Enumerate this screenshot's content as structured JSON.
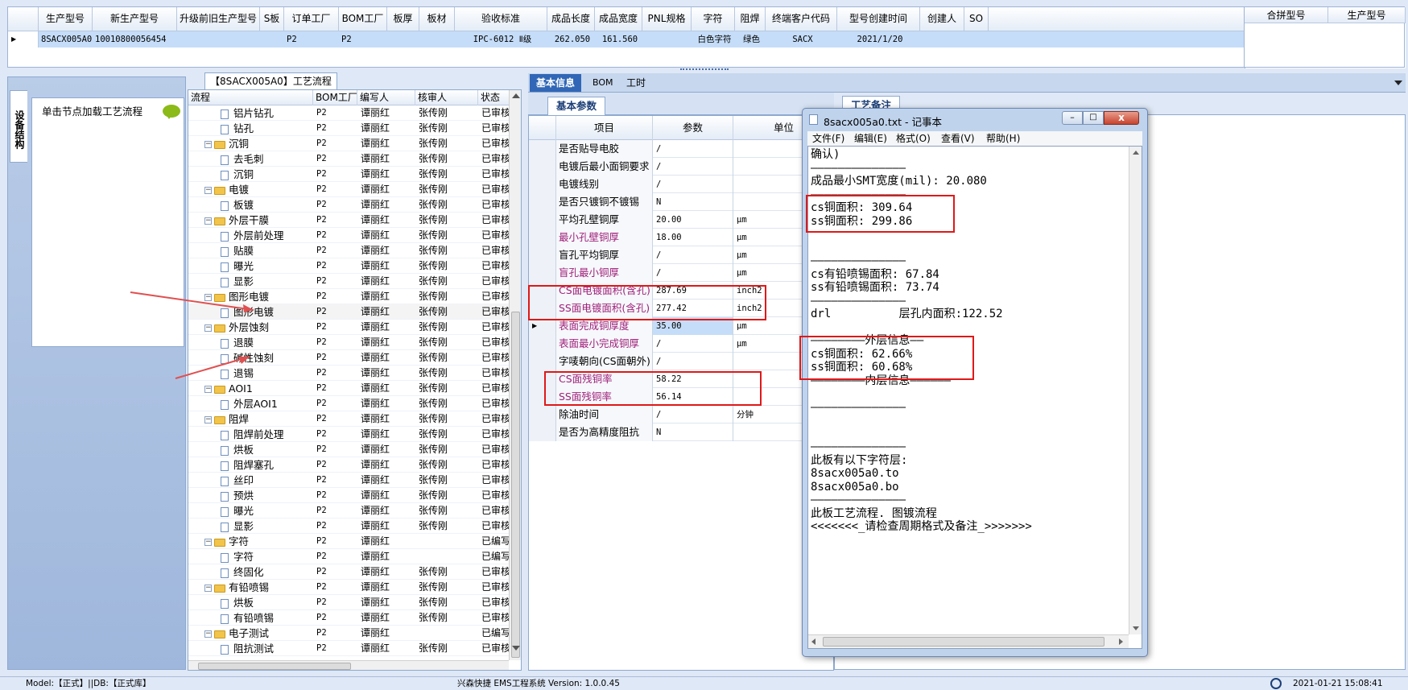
{
  "top_grid": {
    "headers": [
      "生产型号",
      "新生产型号",
      "升级前旧生产型号",
      "S板",
      "订单工厂",
      "BOM工厂",
      "板厚",
      "板材",
      "验收标准",
      "成品长度",
      "成品宽度",
      "PNL规格",
      "字符",
      "阻焊",
      "终端客户代码",
      "型号创建时间",
      "创建人",
      "SO"
    ],
    "row": [
      "8SACX005A0",
      "10010800056454",
      "",
      "",
      "P2",
      "P2",
      "",
      "",
      "IPC-6012 Ⅱ级",
      "262.050",
      "161.560",
      "",
      "白色字符",
      "绿色",
      "SACX",
      "2021/1/20",
      "",
      ""
    ],
    "side_headers": [
      "合拼型号",
      "生产型号"
    ]
  },
  "left_panel": {
    "vertical_tab": "设备结构",
    "hint": "单击节点加载工艺流程"
  },
  "flow_panel": {
    "title": "【8SACX005A0】工艺流程",
    "headers": [
      "流程",
      "BOM工厂",
      "编写人",
      "核审人",
      "状态"
    ],
    "rows": [
      {
        "level": 2,
        "type": "doc",
        "name": "铝片钻孔",
        "bom": "P2",
        "writer": "谭丽红",
        "reviewer": "张传刚",
        "status": "已审核"
      },
      {
        "level": 2,
        "type": "doc",
        "name": "钻孔",
        "bom": "P2",
        "writer": "谭丽红",
        "reviewer": "张传刚",
        "status": "已审核"
      },
      {
        "level": 1,
        "type": "folder",
        "name": "沉铜",
        "bom": "P2",
        "writer": "谭丽红",
        "reviewer": "张传刚",
        "status": "已审核"
      },
      {
        "level": 2,
        "type": "doc",
        "name": "去毛刺",
        "bom": "P2",
        "writer": "谭丽红",
        "reviewer": "张传刚",
        "status": "已审核"
      },
      {
        "level": 2,
        "type": "doc",
        "name": "沉铜",
        "bom": "P2",
        "writer": "谭丽红",
        "reviewer": "张传刚",
        "status": "已审核"
      },
      {
        "level": 1,
        "type": "folder",
        "name": "电镀",
        "bom": "P2",
        "writer": "谭丽红",
        "reviewer": "张传刚",
        "status": "已审核"
      },
      {
        "level": 2,
        "type": "doc",
        "name": "板镀",
        "bom": "P2",
        "writer": "谭丽红",
        "reviewer": "张传刚",
        "status": "已审核"
      },
      {
        "level": 1,
        "type": "folder",
        "name": "外层干膜",
        "bom": "P2",
        "writer": "谭丽红",
        "reviewer": "张传刚",
        "status": "已审核"
      },
      {
        "level": 2,
        "type": "doc",
        "name": "外层前处理",
        "bom": "P2",
        "writer": "谭丽红",
        "reviewer": "张传刚",
        "status": "已审核"
      },
      {
        "level": 2,
        "type": "doc",
        "name": "贴膜",
        "bom": "P2",
        "writer": "谭丽红",
        "reviewer": "张传刚",
        "status": "已审核"
      },
      {
        "level": 2,
        "type": "doc",
        "name": "曝光",
        "bom": "P2",
        "writer": "谭丽红",
        "reviewer": "张传刚",
        "status": "已审核"
      },
      {
        "level": 2,
        "type": "doc",
        "name": "显影",
        "bom": "P2",
        "writer": "谭丽红",
        "reviewer": "张传刚",
        "status": "已审核"
      },
      {
        "level": 1,
        "type": "folder",
        "name": "图形电镀",
        "bom": "P2",
        "writer": "谭丽红",
        "reviewer": "张传刚",
        "status": "已审核"
      },
      {
        "level": 2,
        "type": "doc",
        "name": "图形电镀",
        "bom": "P2",
        "writer": "谭丽红",
        "reviewer": "张传刚",
        "status": "已审核"
      },
      {
        "level": 1,
        "type": "folder",
        "name": "外层蚀刻",
        "bom": "P2",
        "writer": "谭丽红",
        "reviewer": "张传刚",
        "status": "已审核"
      },
      {
        "level": 2,
        "type": "doc",
        "name": "退膜",
        "bom": "P2",
        "writer": "谭丽红",
        "reviewer": "张传刚",
        "status": "已审核"
      },
      {
        "level": 2,
        "type": "doc",
        "name": "碱性蚀刻",
        "bom": "P2",
        "writer": "谭丽红",
        "reviewer": "张传刚",
        "status": "已审核"
      },
      {
        "level": 2,
        "type": "doc",
        "name": "退锡",
        "bom": "P2",
        "writer": "谭丽红",
        "reviewer": "张传刚",
        "status": "已审核"
      },
      {
        "level": 1,
        "type": "folder",
        "name": "AOI1",
        "bom": "P2",
        "writer": "谭丽红",
        "reviewer": "张传刚",
        "status": "已审核"
      },
      {
        "level": 2,
        "type": "doc",
        "name": "外层AOI1",
        "bom": "P2",
        "writer": "谭丽红",
        "reviewer": "张传刚",
        "status": "已审核"
      },
      {
        "level": 1,
        "type": "folder",
        "name": "阻焊",
        "bom": "P2",
        "writer": "谭丽红",
        "reviewer": "张传刚",
        "status": "已审核"
      },
      {
        "level": 2,
        "type": "doc",
        "name": "阻焊前处理",
        "bom": "P2",
        "writer": "谭丽红",
        "reviewer": "张传刚",
        "status": "已审核"
      },
      {
        "level": 2,
        "type": "doc",
        "name": "烘板",
        "bom": "P2",
        "writer": "谭丽红",
        "reviewer": "张传刚",
        "status": "已审核"
      },
      {
        "level": 2,
        "type": "doc",
        "name": "阻焊塞孔",
        "bom": "P2",
        "writer": "谭丽红",
        "reviewer": "张传刚",
        "status": "已审核"
      },
      {
        "level": 2,
        "type": "doc",
        "name": "丝印",
        "bom": "P2",
        "writer": "谭丽红",
        "reviewer": "张传刚",
        "status": "已审核"
      },
      {
        "level": 2,
        "type": "doc",
        "name": "预烘",
        "bom": "P2",
        "writer": "谭丽红",
        "reviewer": "张传刚",
        "status": "已审核"
      },
      {
        "level": 2,
        "type": "doc",
        "name": "曝光",
        "bom": "P2",
        "writer": "谭丽红",
        "reviewer": "张传刚",
        "status": "已审核"
      },
      {
        "level": 2,
        "type": "doc",
        "name": "显影",
        "bom": "P2",
        "writer": "谭丽红",
        "reviewer": "张传刚",
        "status": "已审核"
      },
      {
        "level": 1,
        "type": "folder",
        "name": "字符",
        "bom": "P2",
        "writer": "谭丽红",
        "reviewer": "",
        "status": "已编写"
      },
      {
        "level": 2,
        "type": "doc",
        "name": "字符",
        "bom": "P2",
        "writer": "谭丽红",
        "reviewer": "",
        "status": "已编写"
      },
      {
        "level": 2,
        "type": "doc",
        "name": "终固化",
        "bom": "P2",
        "writer": "谭丽红",
        "reviewer": "张传刚",
        "status": "已审核"
      },
      {
        "level": 1,
        "type": "folder",
        "name": "有铅喷锡",
        "bom": "P2",
        "writer": "谭丽红",
        "reviewer": "张传刚",
        "status": "已审核"
      },
      {
        "level": 2,
        "type": "doc",
        "name": "烘板",
        "bom": "P2",
        "writer": "谭丽红",
        "reviewer": "张传刚",
        "status": "已审核"
      },
      {
        "level": 2,
        "type": "doc",
        "name": "有铅喷锡",
        "bom": "P2",
        "writer": "谭丽红",
        "reviewer": "张传刚",
        "status": "已审核"
      },
      {
        "level": 1,
        "type": "folder",
        "name": "电子测试",
        "bom": "P2",
        "writer": "谭丽红",
        "reviewer": "",
        "status": "已编写"
      },
      {
        "level": 2,
        "type": "doc",
        "name": "阻抗测试",
        "bom": "P2",
        "writer": "谭丽红",
        "reviewer": "张传刚",
        "status": "已审核"
      }
    ]
  },
  "info_panel": {
    "tabs": [
      "基本信息",
      "BOM",
      "工时"
    ],
    "subtab": "基本参数",
    "remark_tab": "工艺备注",
    "headers": [
      "项目",
      "参数",
      "单位"
    ],
    "rows": [
      {
        "item": "是否贴导电胶",
        "value": "/",
        "unit": "",
        "color": "#000000"
      },
      {
        "item": "电镀后最小面铜要求",
        "value": "/",
        "unit": "",
        "color": "#000000"
      },
      {
        "item": "电镀线别",
        "value": "/",
        "unit": "",
        "color": "#000000"
      },
      {
        "item": "是否只镀铜不镀锡",
        "value": "N",
        "unit": "",
        "color": "#000000"
      },
      {
        "item": "平均孔壁铜厚",
        "value": "20.00",
        "unit": "μm",
        "color": "#000000"
      },
      {
        "item": "最小孔壁铜厚",
        "value": "18.00",
        "unit": "μm",
        "color": "#a0207a"
      },
      {
        "item": "盲孔平均铜厚",
        "value": "/",
        "unit": "μm",
        "color": "#000000"
      },
      {
        "item": "盲孔最小铜厚",
        "value": "/",
        "unit": "μm",
        "color": "#a0207a"
      },
      {
        "item": "CS面电镀面积(含孔)",
        "value": "287.69",
        "unit": "inch2",
        "color": "#a0207a"
      },
      {
        "item": "SS面电镀面积(含孔)",
        "value": "277.42",
        "unit": "inch2",
        "color": "#a0207a"
      },
      {
        "item": "表面完成铜厚度",
        "value": "35.00",
        "unit": "μm",
        "color": "#a0207a"
      },
      {
        "item": "表面最小完成铜厚",
        "value": "/",
        "unit": "μm",
        "color": "#a0207a"
      },
      {
        "item": "字唛朝向(CS面朝外)",
        "value": "/",
        "unit": "",
        "color": "#000000"
      },
      {
        "item": "CS面残铜率",
        "value": "58.22",
        "unit": "",
        "color": "#a0207a"
      },
      {
        "item": "SS面残铜率",
        "value": "56.14",
        "unit": "",
        "color": "#a0207a"
      },
      {
        "item": "除油时间",
        "value": "/",
        "unit": "分钟",
        "color": "#000000"
      },
      {
        "item": "是否为高精度阻抗",
        "value": "N",
        "unit": "",
        "color": "#000000"
      }
    ]
  },
  "notepad": {
    "title": "8sacx005a0.txt - 记事本",
    "menu": [
      "文件(F)",
      "编辑(E)",
      "格式(O)",
      "查看(V)",
      "帮助(H)"
    ],
    "lines": [
      "确认)",
      "——————————————",
      "成品最小SMT宽度(mil): 20.080",
      "——————————————",
      "cs铜面积: 309.64",
      "ss铜面积: 299.86",
      "",
      "",
      "——————————————",
      "cs有铅喷锡面积: 67.84",
      "ss有铅喷锡面积: 73.74",
      "——————————————",
      "drl          层孔内面积:122.52",
      "",
      "————————外层信息——",
      "cs铜面积: 62.66%",
      "ss铜面积: 60.68%",
      "————————内层信息——————",
      "",
      "——————————————",
      "",
      "",
      "——————————————",
      "此板有以下字符层:",
      "8sacx005a0.to",
      "8sacx005a0.bo",
      "——————————————",
      "此板工艺流程. 图镀流程",
      "<<<<<<<_请检查周期格式及备注_>>>>>>>"
    ]
  },
  "status_bar": {
    "left": "Model:【正式】||DB:【正式库】",
    "center": "兴森快捷 EMS工程系统 Version: 1.0.0.45",
    "datetime": "2021-01-21 15:08:41"
  },
  "colors": {
    "accent": "#3167b6",
    "highlight_red": "#e01818",
    "label_purple": "#a0207a"
  }
}
